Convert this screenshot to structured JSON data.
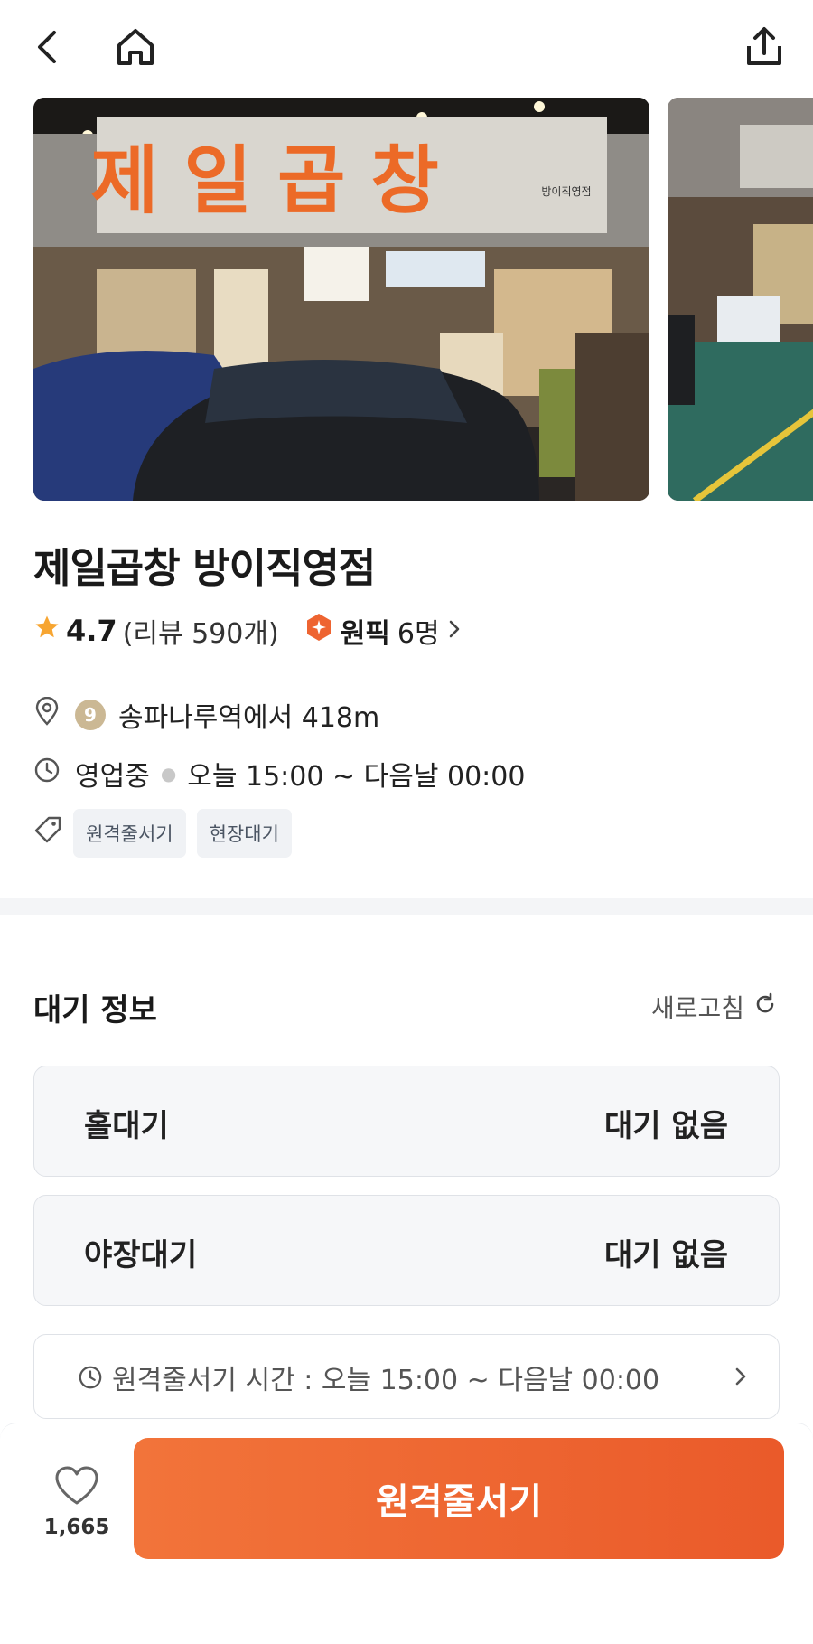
{
  "store": {
    "name": "제일곱창 방이직영점",
    "rating": "4.7",
    "review_text": "(리뷰 590개)",
    "pick_label": "원픽",
    "pick_count": "6명",
    "station_line": "9",
    "distance_text": "송파나루역에서 418m",
    "status": "영업중",
    "hours": "오늘 15:00 ~ 다음날 00:00",
    "tags": [
      "원격줄서기",
      "현장대기"
    ]
  },
  "photos": {
    "sign_text": "제일곱창",
    "sign_sub": "방이직영점"
  },
  "wait": {
    "title": "대기 정보",
    "refresh_label": "새로고침",
    "items": [
      {
        "label": "홀대기",
        "value": "대기 없음"
      },
      {
        "label": "야장대기",
        "value": "대기 없음"
      }
    ],
    "remote_time": "원격줄서기 시간 : 오늘 15:00 ~ 다음날 00:00"
  },
  "bottom": {
    "like_count": "1,665",
    "cta_label": "원격줄서기"
  },
  "colors": {
    "accent": "#ee6431",
    "star": "#f7a531",
    "badge": "#cbb894"
  }
}
